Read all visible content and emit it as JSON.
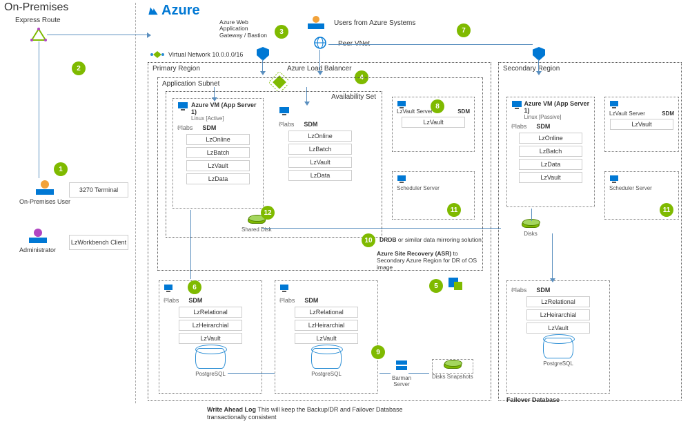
{
  "onprem": {
    "title": "On-Premises",
    "express_route": "Express Route",
    "user_label": "On-Premises User",
    "admin_label": "Administrator",
    "terminal_box": "3270 Terminal",
    "workbench_box": "LzWorkbench Client"
  },
  "azure": {
    "title": "Azure",
    "vnet_label": "Virtual Network 10.0.0.0/16",
    "gateway_label": "Azure Web\nApplication\nGateway / Bastion",
    "users_label": "Users from Azure Systems",
    "peer_label": "Peer VNet",
    "load_balancer_label": "Azure Load Balancer"
  },
  "primary": {
    "label": "Primary Region",
    "app_subnet_label": "Application Subnet",
    "avail_set_label": "Availability Set",
    "vm1": {
      "title": "Azure VM (App Server 1)",
      "sub": "Linux [Active]",
      "tlabs": "labs",
      "sdm": "SDM",
      "mods": [
        "LzOnline",
        "LzBatch",
        "LzVault",
        "LzData"
      ]
    },
    "vm2": {
      "sdm": "SDM",
      "mods": [
        "LzOnline",
        "LzBatch",
        "LzVault",
        "LzData"
      ]
    },
    "shared_disk": "Shared  Disk",
    "lzvault_server": "LzVault Server",
    "lzvault_sdm": "SDM",
    "lzvault_mod": "LzVault",
    "scheduler": "Scheduler Server",
    "drdb_note": "DRDB or similar data mirroring solution",
    "asr_note_bold": "Azure Site Recovery (ASR)",
    "asr_note_rest": " to Secondary Azure Region for DR of OS image",
    "db1": {
      "sdm": "SDM",
      "mods": [
        "LzRelational",
        "LzHeirarchial",
        "LzVault"
      ],
      "db_label": "PostgreSQL"
    },
    "db2": {
      "sdm": "SDM",
      "mods": [
        "LzRelational",
        "LzHeirarchial",
        "LzVault"
      ],
      "db_label": "PostgreSQL"
    },
    "barman": "Barman\nServer",
    "snapshots": "Disks Snapshots"
  },
  "secondary": {
    "label": "Secondary Region",
    "vm": {
      "title": "Azure VM (App Server 1)",
      "sub": "Linux [Passive]",
      "sdm": "SDM",
      "mods": [
        "LzOnline",
        "LzBatch",
        "LzData",
        "LzVault"
      ]
    },
    "lzvault_server": "LzVault Server",
    "lzvault_sdm": "SDM",
    "lzvault_mod": "LzVault",
    "scheduler": "Scheduler Server",
    "disks": "Disks",
    "db": {
      "sdm": "SDM",
      "mods": [
        "LzRelational",
        "LzHeirarchial",
        "LzVault"
      ],
      "db_label": "PostgreSQL"
    },
    "failover": "Failover Database"
  },
  "footer": {
    "bold": "Write Ahead Log",
    "rest": " This will keep the Backup/DR and Failover Database transactionally consistent"
  },
  "badges": {
    "b1": "1",
    "b2": "2",
    "b3": "3",
    "b4": "4",
    "b5": "5",
    "b6": "6",
    "b7": "7",
    "b8": "8",
    "b9": "9",
    "b10": "10",
    "b11a": "11",
    "b11b": "11",
    "b12": "12"
  }
}
